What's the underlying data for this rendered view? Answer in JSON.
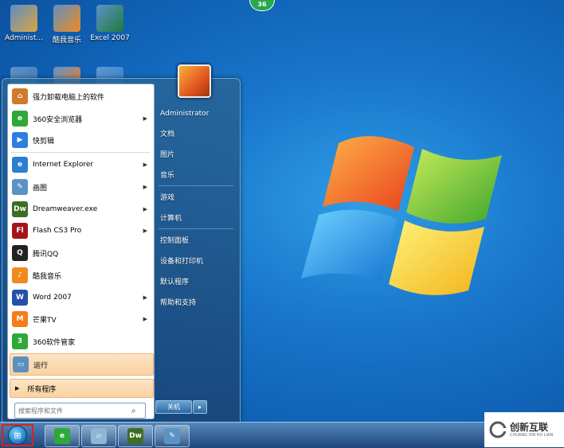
{
  "desktop": {
    "notification_count": "36",
    "icons": [
      {
        "label": "Administ...",
        "icon": "user-folder-icon",
        "color": "#d9a441"
      },
      {
        "label": "酷我音乐",
        "icon": "kuwo-music-icon",
        "color": "#f08a1d"
      },
      {
        "label": "Excel 2007",
        "icon": "excel-icon",
        "color": "#1f7a3a"
      },
      {
        "label": "",
        "icon": "computer-icon",
        "color": "#3a78c0"
      },
      {
        "label": "",
        "icon": "mango-tv-icon",
        "color": "#f57d1b"
      },
      {
        "label": "",
        "icon": "ie-icon",
        "color": "#2b7fd1"
      }
    ]
  },
  "start_menu": {
    "programs": [
      {
        "label": "强力卸载电脑上的软件",
        "icon": "uninstall-icon",
        "color": "#d07a2b",
        "glyph": "⌂",
        "arrow": false
      },
      {
        "label": "360安全浏览器",
        "icon": "360-browser-icon",
        "color": "#2fa83a",
        "glyph": "e",
        "arrow": true
      },
      {
        "label": "快剪辑",
        "icon": "kuaijianji-icon",
        "color": "#2d7ee0",
        "glyph": "▶",
        "arrow": false
      },
      {
        "label": "Internet Explorer",
        "icon": "ie-icon",
        "color": "#2b7fd1",
        "glyph": "e",
        "arrow": true
      },
      {
        "label": "画图",
        "icon": "paint-icon",
        "color": "#5b93c7",
        "glyph": "✎",
        "arrow": true
      },
      {
        "label": "Dreamweaver.exe",
        "icon": "dreamweaver-icon",
        "color": "#3f6d24",
        "glyph": "Dw",
        "arrow": true
      },
      {
        "label": "Flash CS3 Pro",
        "icon": "flash-icon",
        "color": "#a3141b",
        "glyph": "Fl",
        "arrow": true
      },
      {
        "label": "腾讯QQ",
        "icon": "qq-icon",
        "color": "#222222",
        "glyph": "Q",
        "arrow": false
      },
      {
        "label": "酷我音乐",
        "icon": "kuwo-music-icon",
        "color": "#f08a1d",
        "glyph": "♪",
        "arrow": false
      },
      {
        "label": "Word 2007",
        "icon": "word-icon",
        "color": "#2451a8",
        "glyph": "W",
        "arrow": true
      },
      {
        "label": "芒果TV",
        "icon": "mango-tv-icon",
        "color": "#f57d1b",
        "glyph": "M",
        "arrow": true
      },
      {
        "label": "360软件管家",
        "icon": "360-software-icon",
        "color": "#2fa83a",
        "glyph": "3",
        "arrow": false
      },
      {
        "label": "运行",
        "icon": "run-icon",
        "color": "#5b8fc0",
        "glyph": "▭",
        "arrow": false
      }
    ],
    "all_programs_label": "所有程序",
    "search_placeholder": "搜索程序和文件",
    "user_name": "Administrator",
    "right_items": [
      {
        "label": "文档",
        "group": 1
      },
      {
        "label": "图片",
        "group": 1
      },
      {
        "label": "音乐",
        "group": 1
      },
      {
        "label": "游戏",
        "group": 2
      },
      {
        "label": "计算机",
        "group": 2
      },
      {
        "label": "控制面板",
        "group": 3
      },
      {
        "label": "设备和打印机",
        "group": 3
      },
      {
        "label": "默认程序",
        "group": 3
      },
      {
        "label": "帮助和支持",
        "group": 3
      }
    ],
    "shutdown_label": "关机",
    "shutdown_arrow": "▸"
  },
  "taskbar": {
    "buttons": [
      {
        "icon": "360-browser-icon",
        "glyph": "e",
        "color": "#2fa83a"
      },
      {
        "icon": "notebook-icon",
        "glyph": "▱",
        "color": "#8fb6d6"
      },
      {
        "icon": "dreamweaver-icon",
        "glyph": "Dw",
        "color": "#3f6d24"
      },
      {
        "icon": "paint-icon",
        "glyph": "✎",
        "color": "#5b93c7"
      }
    ]
  },
  "watermark": {
    "text": "创新互联",
    "subtext": "CHUANG XIN HU LIAN"
  }
}
